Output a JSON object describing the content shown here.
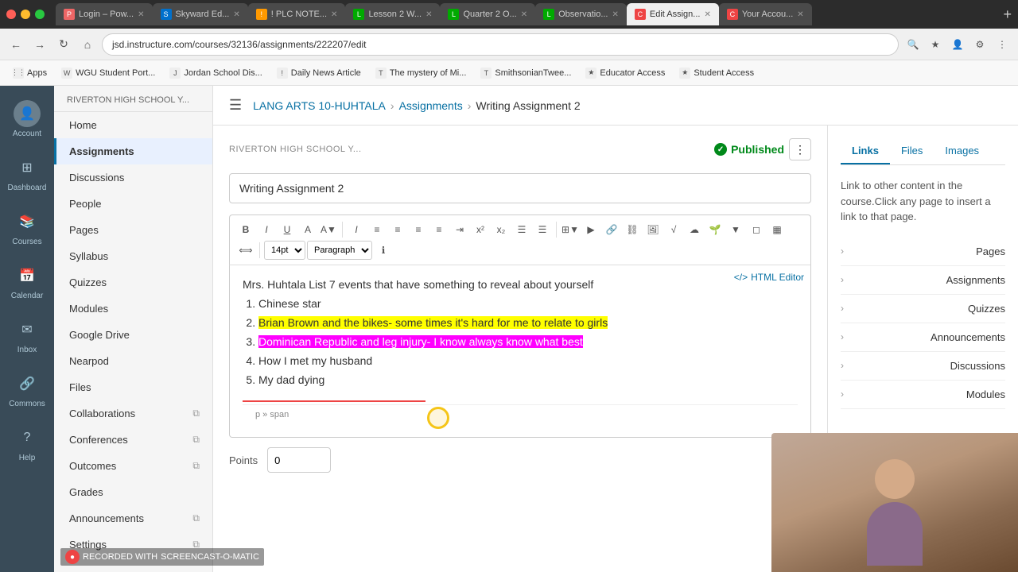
{
  "browser": {
    "tabs": [
      {
        "id": "t1",
        "label": "Login – Pow...",
        "favicon_color": "#e66",
        "active": false
      },
      {
        "id": "t2",
        "label": "Skyward Ed...",
        "favicon_color": "#0070cc",
        "active": false
      },
      {
        "id": "t3",
        "label": "! PLC NOTE...",
        "favicon_color": "#f90",
        "active": false
      },
      {
        "id": "t4",
        "label": "Lesson 2 W...",
        "favicon_color": "#0a0",
        "active": false
      },
      {
        "id": "t5",
        "label": "Quarter 2 O...",
        "favicon_color": "#0a0",
        "active": false
      },
      {
        "id": "t6",
        "label": "Observatio...",
        "favicon_color": "#0a0",
        "active": false
      },
      {
        "id": "t7",
        "label": "Edit Assign...",
        "favicon_color": "#e44",
        "active": true
      },
      {
        "id": "t8",
        "label": "Your Accou...",
        "favicon_color": "#e44",
        "active": false
      }
    ],
    "address": "jsd.instructure.com/courses/32136/assignments/222207/edit",
    "bookmarks": [
      {
        "label": "Apps",
        "icon": "⋮⋮"
      },
      {
        "label": "WGU Student Port...",
        "icon": "W"
      },
      {
        "label": "Jordan School Dis...",
        "icon": "J"
      },
      {
        "label": "Daily News Article",
        "icon": "!"
      },
      {
        "label": "The mystery of Mi...",
        "icon": "T"
      },
      {
        "label": "SmithsonianTwee...",
        "icon": "T"
      },
      {
        "label": "Educator Access",
        "icon": "★"
      },
      {
        "label": "Student Access",
        "icon": "★"
      }
    ]
  },
  "global_nav": {
    "items": [
      {
        "label": "Account",
        "icon": "👤"
      },
      {
        "label": "Dashboard",
        "icon": "⊞"
      },
      {
        "label": "Courses",
        "icon": "📚"
      },
      {
        "label": "Calendar",
        "icon": "📅"
      },
      {
        "label": "Inbox",
        "icon": "✉"
      },
      {
        "label": "Commons",
        "icon": "🔗"
      },
      {
        "label": "Help",
        "icon": "?"
      }
    ]
  },
  "course_nav": {
    "school_label": "RIVERTON HIGH SCHOOL Y...",
    "items": [
      {
        "label": "Home",
        "active": false,
        "has_icon": false
      },
      {
        "label": "Assignments",
        "active": true,
        "has_icon": false
      },
      {
        "label": "Discussions",
        "active": false,
        "has_icon": false
      },
      {
        "label": "People",
        "active": false,
        "has_icon": false
      },
      {
        "label": "Pages",
        "active": false,
        "has_icon": false
      },
      {
        "label": "Syllabus",
        "active": false,
        "has_icon": false
      },
      {
        "label": "Quizzes",
        "active": false,
        "has_icon": false
      },
      {
        "label": "Modules",
        "active": false,
        "has_icon": false
      },
      {
        "label": "Google Drive",
        "active": false,
        "has_icon": false
      },
      {
        "label": "Nearpod",
        "active": false,
        "has_icon": false
      },
      {
        "label": "Files",
        "active": false,
        "has_icon": false
      },
      {
        "label": "Collaborations",
        "active": false,
        "has_icon": true
      },
      {
        "label": "Conferences",
        "active": false,
        "has_icon": true
      },
      {
        "label": "Outcomes",
        "active": false,
        "has_icon": true
      },
      {
        "label": "Grades",
        "active": false,
        "has_icon": false
      },
      {
        "label": "Announcements",
        "active": false,
        "has_icon": true
      },
      {
        "label": "Settings",
        "active": false,
        "has_icon": true
      }
    ]
  },
  "breadcrumb": {
    "course": "LANG ARTS 10-HUHTALA",
    "section": "Assignments",
    "current": "Writing Assignment 2"
  },
  "editor": {
    "school_label": "RIVERTON HIGH SCHOOL Y...",
    "published_label": "Published",
    "title_value": "Writing Assignment 2",
    "html_editor_label": "HTML Editor",
    "toolbar": {
      "font_size": "14pt",
      "paragraph": "Paragraph"
    },
    "content_intro": "Mrs. Huhtala",
    "content_prompt": "List 7 events that have something to reveal about yourself",
    "list_items": [
      {
        "num": 1,
        "text": "Chinese star",
        "highlight": "none"
      },
      {
        "num": 2,
        "text": "Brian Brown and the bikes- some times it's hard for me to relate to girls",
        "highlight": "yellow"
      },
      {
        "num": 3,
        "text": "Dominican Republic and leg injury- I know always know what best",
        "highlight": "magenta"
      },
      {
        "num": 4,
        "text": "How I met my husband",
        "highlight": "none"
      },
      {
        "num": 5,
        "text": "My dad dying",
        "highlight": "none"
      }
    ],
    "status_text": "p » span",
    "points_label": "Points",
    "points_value": "0"
  },
  "right_panel": {
    "tabs": [
      {
        "label": "Links",
        "active": true
      },
      {
        "label": "Files",
        "active": false
      },
      {
        "label": "Images",
        "active": false
      }
    ],
    "description": "Link to other content in the course.Click any page to insert a link to that page.",
    "items": [
      {
        "label": "Pages"
      },
      {
        "label": "Assignments"
      },
      {
        "label": "Quizzes"
      },
      {
        "label": "Announcements"
      },
      {
        "label": "Discussions"
      },
      {
        "label": "Modules"
      }
    ]
  },
  "watermark": {
    "text": "RECORDED WITH",
    "brand": "SCREENCAST-O-MATIC"
  }
}
